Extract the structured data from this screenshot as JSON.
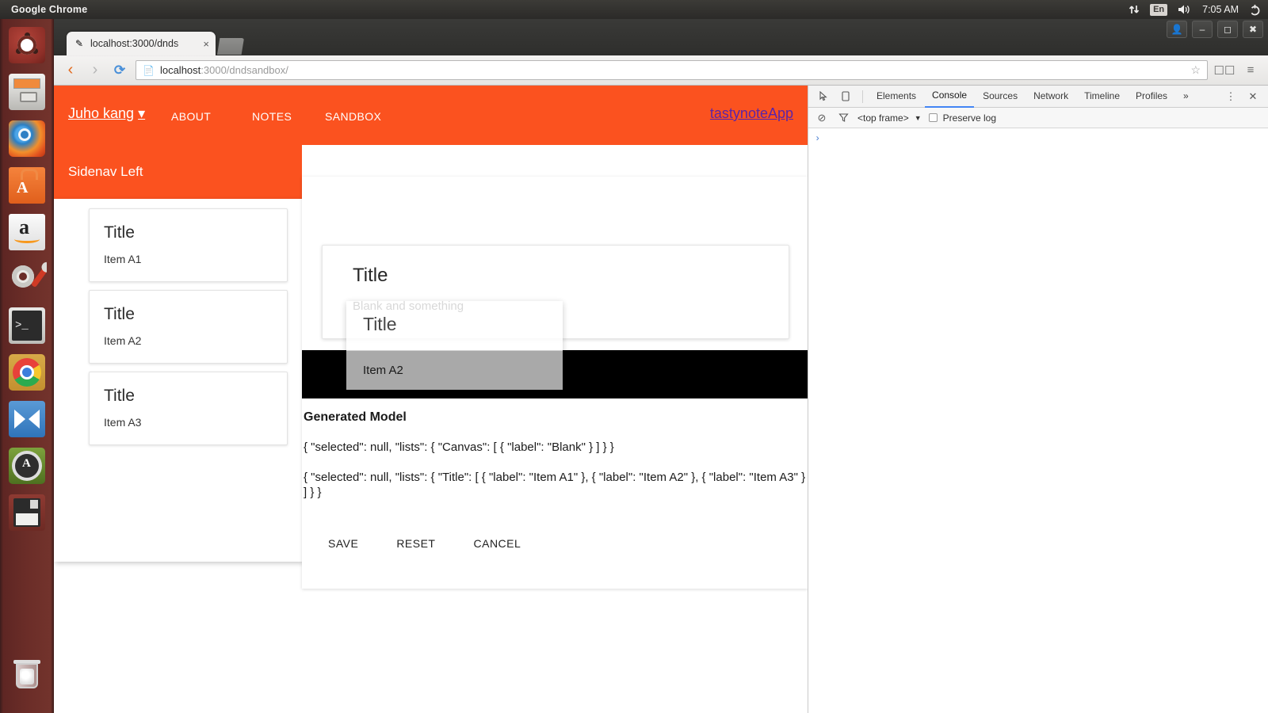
{
  "desktop": {
    "panel": {
      "app_title": "Google Chrome",
      "indicators": [
        "network-icon",
        "keyboard-icon",
        "volume-icon"
      ],
      "keyboard_layout": "En",
      "clock": "7:05 AM",
      "session_icon": "power-gear-icon"
    },
    "launcher": {
      "items": [
        {
          "name": "ubuntu-dash",
          "label": "Dash home"
        },
        {
          "name": "files",
          "label": "Files"
        },
        {
          "name": "firefox",
          "label": "Firefox Web Browser"
        },
        {
          "name": "ubuntu-software",
          "label": "Ubuntu Software Center"
        },
        {
          "name": "amazon",
          "label": "Amazon"
        },
        {
          "name": "system-settings",
          "label": "System Settings"
        },
        {
          "name": "terminal",
          "label": "Terminal"
        },
        {
          "name": "google-chrome",
          "label": "Google Chrome"
        },
        {
          "name": "visual-studio-code",
          "label": "Visual Studio Code"
        },
        {
          "name": "software-updater",
          "label": "Software Updater"
        },
        {
          "name": "workspace-switcher",
          "label": "Save / Disk"
        }
      ],
      "trash": {
        "name": "trash",
        "label": "Trash"
      }
    }
  },
  "browser": {
    "window_buttons": [
      "profile",
      "minimize",
      "maximize",
      "close"
    ],
    "tab": {
      "title": "localhost:3000/dnds",
      "favicon": "page-edit-icon",
      "close_label": "×"
    },
    "new_tab_label": "",
    "toolbar": {
      "back": "‹",
      "forward": "›",
      "reload": "⟳",
      "page_icon": "☷",
      "url_host": "localhost",
      "url_path": ":3000/dndsandbox/",
      "star": "☆",
      "extension_icon": "extensions-icon",
      "menu_icon": "≡"
    }
  },
  "app": {
    "topnav": {
      "brand": "Juho kang",
      "brand_caret": "▾",
      "links": [
        "ABOUT",
        "NOTES",
        "SANDBOX"
      ],
      "app_link": "tastynoteApp",
      "accent_color": "#fb521f",
      "app_link_color": "#5b24a8"
    },
    "sidenav": {
      "heading": "Sidenav Left",
      "cards": [
        {
          "title": "Title",
          "body": "Item A1"
        },
        {
          "title": "Title",
          "body": "Item A2"
        },
        {
          "title": "Title",
          "body": "Item A3"
        }
      ]
    },
    "canvas": {
      "card": {
        "title": "Title",
        "body": "Blank and something"
      }
    },
    "drag_ghost": {
      "title": "Title",
      "body": "Item A2"
    },
    "model": {
      "heading": "Generated Model",
      "lines": [
        "{ \"selected\": null, \"lists\": { \"Canvas\": [ { \"label\": \"Blank\" } ] } }",
        "{ \"selected\": null, \"lists\": { \"Title\": [ { \"label\": \"Item A1\" }, { \"label\": \"Item A2\" }, { \"label\": \"Item A3\" } ] } }"
      ]
    },
    "actions": [
      "SAVE",
      "RESET",
      "CANCEL"
    ]
  },
  "devtools": {
    "left_icons": [
      "inspect-element-icon",
      "device-toolbar-icon"
    ],
    "tabs": [
      "Elements",
      "Console",
      "Sources",
      "Network",
      "Timeline",
      "Profiles"
    ],
    "active_tab": "Console",
    "overflow": "»",
    "more_menu": "⋮",
    "close": "✕",
    "filterbar": {
      "clear_icon": "⊘",
      "filter_icon": "filter-funnel-icon",
      "frame": "<top frame>",
      "frame_caret": "▼",
      "preserve_log_label": "Preserve log",
      "preserve_log_checked": false
    },
    "console_prompt": "›"
  }
}
